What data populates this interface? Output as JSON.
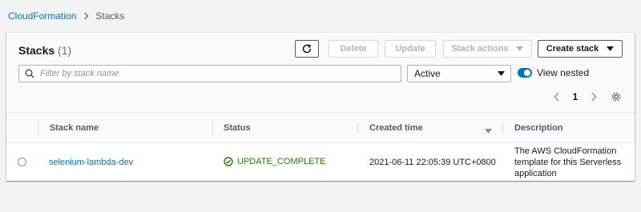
{
  "breadcrumb": {
    "root": "CloudFormation",
    "current": "Stacks"
  },
  "panel": {
    "title": "Stacks",
    "count": "(1)"
  },
  "toolbar": {
    "delete_label": "Delete",
    "update_label": "Update",
    "stack_actions_label": "Stack actions",
    "create_stack_label": "Create stack"
  },
  "filter": {
    "placeholder": "Filter by stack name",
    "value": ""
  },
  "status_filter": {
    "selected": "Active"
  },
  "view_nested": {
    "label": "View nested",
    "enabled": true
  },
  "pagination": {
    "current_page": "1"
  },
  "table": {
    "columns": [
      "Stack name",
      "Status",
      "Created time",
      "Description"
    ],
    "rows": [
      {
        "stack_name": "selenium-lambda-dev",
        "status": "UPDATE_COMPLETE",
        "created_time": "2021-06-11 22:05:39 UTC+0800",
        "description": "The AWS CloudFormation template for this Serverless application"
      }
    ]
  },
  "colors": {
    "link": "#0073bb",
    "success": "#1d8102",
    "toggle_on": "#0073bb"
  },
  "icons": [
    "chevron-right-icon",
    "refresh-icon",
    "caret-down-icon",
    "search-icon",
    "chevron-left-icon",
    "settings-gear-icon",
    "sort-caret-icon",
    "status-success-icon"
  ]
}
